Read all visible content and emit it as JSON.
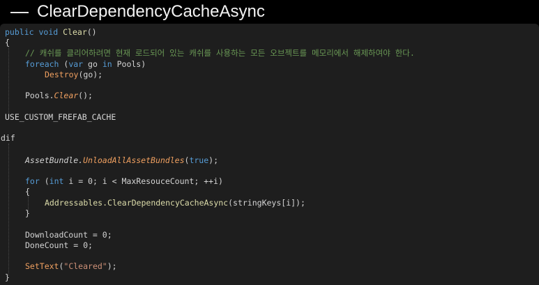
{
  "title": "ClearDependencyCacheAsync",
  "code": {
    "l01_kw1": "public",
    "l01_kw2": "void",
    "l01_fn": "Clear",
    "l01_rest": "()",
    "l02": "{",
    "l03_comment": "// 캐쉬를 클리어하려면 현재 로드되어 있는 캐쉬를 사용하는 모든 오브젝트를 메모리에서 해제하여야 한다.",
    "l04_kw": "foreach",
    "l04_a": " (",
    "l04_var": "var",
    "l04_b": " go ",
    "l04_in": "in",
    "l04_c": " Pools)",
    "l05_fn": "Destroy",
    "l05_rest": "(go);",
    "l06_obj": "Pools.",
    "l06_fn": "Clear",
    "l06_rest": "();",
    "l07": "USE_CUSTOM_FREFAB_CACHE",
    "l08": "dif",
    "l09_cls": "AssetBundle.",
    "l09_fn": "UnloadAllAssetBundles",
    "l09_a": "(",
    "l09_val": "true",
    "l09_b": ");",
    "l10_for": "for",
    "l10_a": " (",
    "l10_int": "int",
    "l10_b": " i = 0; i < MaxResouceCount; ++i)",
    "l11": "{",
    "l12_cls": "Addressables.",
    "l12_fn": "ClearDependencyCacheAsync",
    "l12_rest": "(stringKeys[i]);",
    "l13": "}",
    "l14": "DownloadCount = 0;",
    "l15": "DoneCount = 0;",
    "l16_fn": "SetText",
    "l16_a": "(",
    "l16_str": "\"Cleared\"",
    "l16_b": ");",
    "l17": "}"
  },
  "colors": {
    "keyword": "#569cd6",
    "function": "#dcdcaa",
    "class": "#4ec9b0",
    "comment": "#6a9955",
    "string": "#ce9178",
    "background": "#1e1e1e"
  }
}
